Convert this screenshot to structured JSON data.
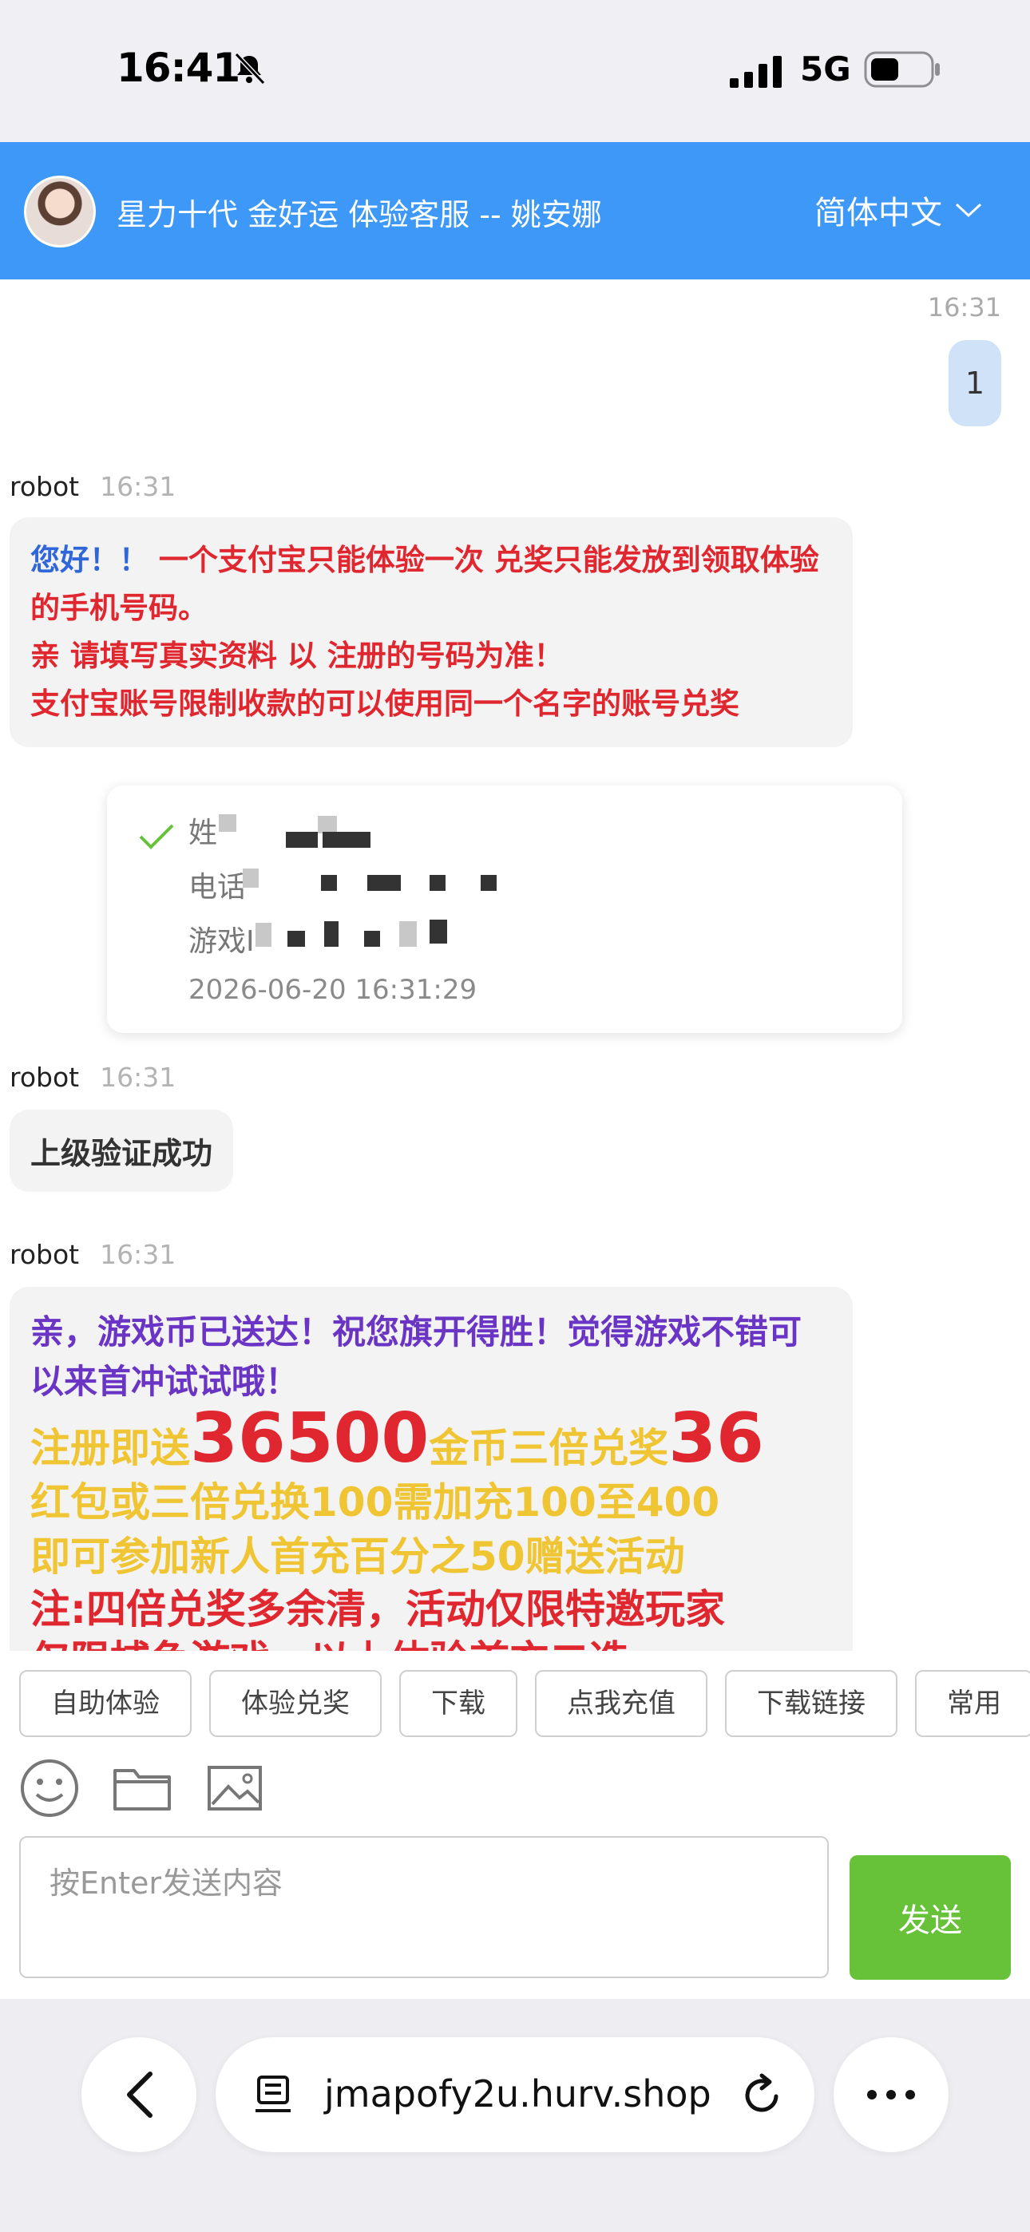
{
  "status_bar": {
    "time": "16:41",
    "network": "5G",
    "icons": [
      "bell-slash-icon",
      "cellular-signal-icon",
      "battery-icon"
    ]
  },
  "header": {
    "title": "星力十代 金好运 体验客服 -- 姚安娜",
    "language": "简体中文",
    "icons": [
      "avatar",
      "chevron-down-icon"
    ]
  },
  "chat": {
    "my_message": {
      "time": "16:31",
      "text": "1"
    },
    "messages": [
      {
        "sender": "robot",
        "time": "16:31",
        "greeting": "您好！！",
        "line1": " 一个支付宝只能体验一次 兑奖只能发放到领取体验的手机号码。",
        "line2": "亲 请填写真实资料 以 注册的号码为准！",
        "line3": "支付宝账号限制收款的可以使用同一个名字的账号兑奖"
      },
      {
        "sender": "robot",
        "time": "16:31",
        "text": "上级验证成功"
      },
      {
        "sender": "robot",
        "time": "16:31",
        "line1": "亲，游戏币已送达！祝您旗开得胜！觉得游戏不错可以来首冲试试哦！",
        "line2a": "注册即送",
        "line2b": "36500",
        "line2c": "金币三倍兑奖",
        "line2d": "36",
        "line3": "红包或三倍兑换100需加充100至400",
        "line4": "即可参加新人首充百分之50赠送活动",
        "line5": "注:四倍兑奖多余清，活动仅限特邀玩家",
        "line6": "仅限捕鱼游戏，以上体验首充二选一"
      }
    ],
    "form_card": {
      "label_name": "姓",
      "label_phone": "电话",
      "label_game_id": "游戏I",
      "timestamp": "2026-06-20 16:31:29"
    }
  },
  "quick_replies": [
    "自助体验",
    "体验兑奖",
    "下载",
    "点我充值",
    "下载链接",
    "常用"
  ],
  "composer": {
    "placeholder": "按Enter发送内容",
    "send_label": "发送",
    "tool_icons": [
      "emoji-icon",
      "folder-icon",
      "image-icon"
    ]
  },
  "browser": {
    "url": "jmapofy2u.hurv.shop",
    "icons": [
      "back-chevron-icon",
      "page-menu-icon",
      "reload-icon",
      "more-icon"
    ]
  },
  "colors": {
    "header_bg": "#3d98f8",
    "my_bubble": "#cfe2f8",
    "send_button": "#67c23a",
    "text_blue": "#2f66d9",
    "text_red": "#e0262e",
    "text_purple": "#6a35c4",
    "text_yellow": "#f0c534"
  }
}
